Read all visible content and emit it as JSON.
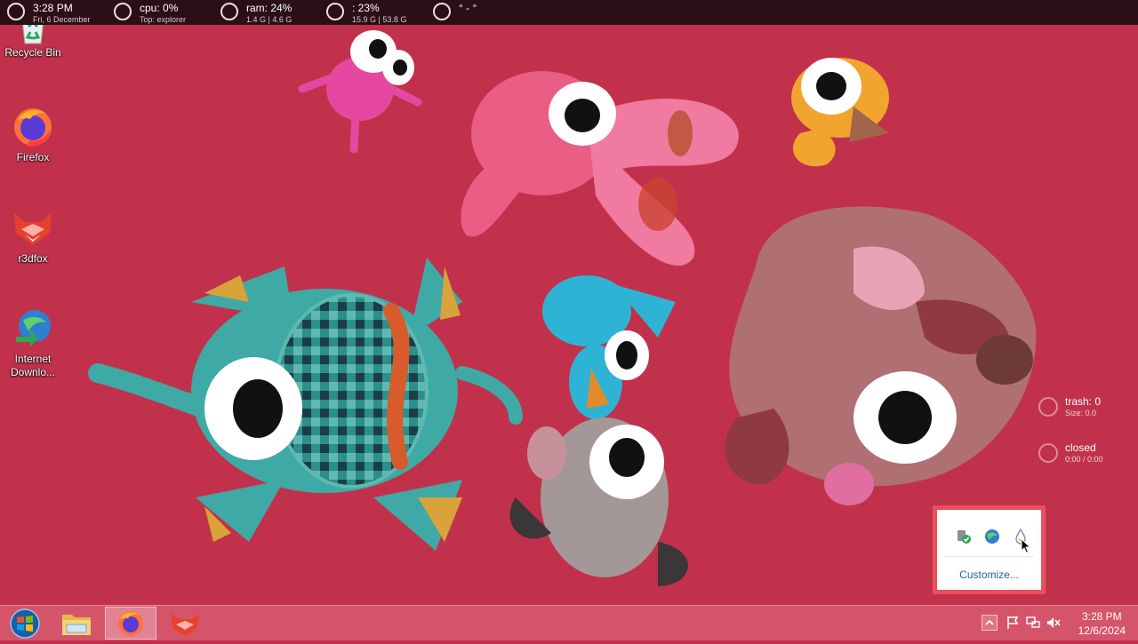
{
  "topbar": {
    "meters": [
      {
        "id": "clock",
        "line1": "3:28 PM",
        "line2": "Fri, 6 December"
      },
      {
        "id": "cpu",
        "line1": "cpu: 0%",
        "line2": "Top: explorer"
      },
      {
        "id": "ram",
        "line1": "ram: 24%",
        "line2": "1.4 G | 4.6 G"
      },
      {
        "id": "disk",
        "line1": ": 23%",
        "line2": "15.9 G | 53.8 G"
      },
      {
        "id": "weather",
        "line1": "° - °",
        "line2": ""
      }
    ]
  },
  "desktop": {
    "icons": [
      {
        "label": "Recycle Bin",
        "icon": "recycle-bin-icon"
      },
      {
        "label": "Firefox",
        "icon": "firefox-icon"
      },
      {
        "label": "r3dfox",
        "icon": "r3dfox-icon"
      },
      {
        "label": "Internet Downlo...",
        "icon": "internet-download-manager-icon"
      }
    ]
  },
  "side_meters": {
    "trash": {
      "line1": "trash: 0",
      "line2": "Size: 0.0"
    },
    "media": {
      "line1": "closed",
      "line2": "0:00 / 0:00"
    }
  },
  "tray_popup": {
    "icons": [
      "usb-safely-remove-icon",
      "network-globe-icon",
      "droplet-icon"
    ],
    "customize_label": "Customize..."
  },
  "taskbar": {
    "items": [
      {
        "name": "start-button",
        "icon": "windows-logo-icon"
      },
      {
        "name": "file-explorer-button",
        "icon": "folder-icon"
      },
      {
        "name": "firefox-taskbar-button",
        "icon": "firefox-icon",
        "active": true
      },
      {
        "name": "r3dfox-taskbar-button",
        "icon": "r3dfox-icon"
      }
    ],
    "tray_icons": [
      "show-hidden-icons-chevron-icon",
      "action-center-flag-icon",
      "network-icon",
      "volume-muted-icon"
    ],
    "clock": {
      "time": "3:28 PM",
      "date": "12/6/2024"
    }
  },
  "colors": {
    "wallpaper": "#c2314c",
    "taskbar": "#d4546a",
    "topbar": "#2a0f17",
    "popup_highlight": "#e94f5d",
    "link": "#1f5fae"
  }
}
